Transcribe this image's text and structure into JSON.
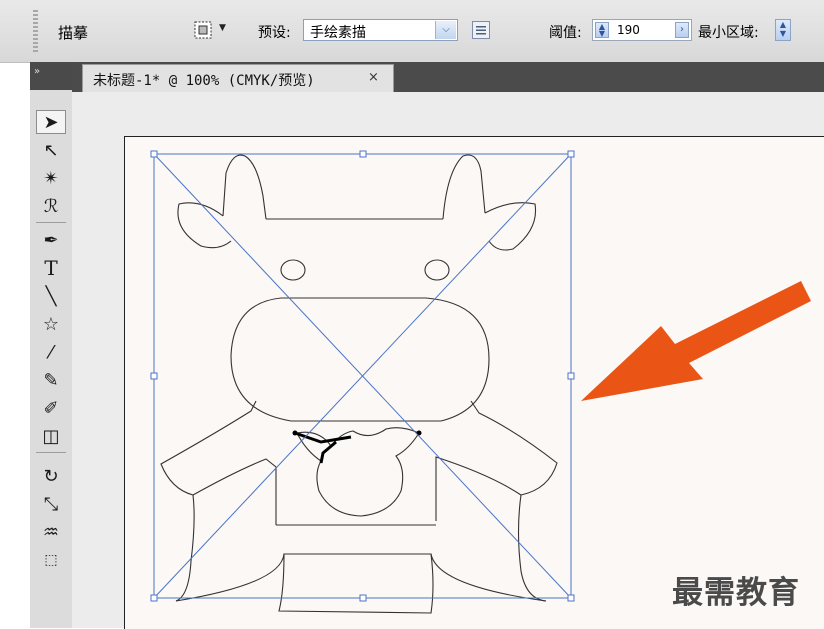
{
  "control_bar": {
    "tool_name": "描摹",
    "preset": {
      "label": "预设:",
      "value": "手绘素描",
      "icon": "trace-preset-icon",
      "dropdown_icon": "chevron-down-icon"
    },
    "options_icon": "tracing-options-icon",
    "threshold": {
      "label": "阈值:",
      "value": "190"
    },
    "min_area": {
      "label": "最小区域:"
    }
  },
  "document": {
    "tab_title": "未标题-1* @ 100% (CMYK/预览)",
    "close_symbol": "×"
  },
  "toolbox": {
    "collapse_symbol": "»",
    "tools": [
      "selection-tool-icon",
      "direct-selection-tool-icon",
      "magic-wand-icon",
      "lasso-icon",
      "pen-icon",
      "type-icon",
      "line-segment-icon",
      "star-icon",
      "paintbrush-icon",
      "pencil-icon",
      "blob-brush-icon",
      "eraser-icon",
      "rotate-icon",
      "scale-icon",
      "warp-icon",
      "free-transform-icon"
    ]
  },
  "canvas": {
    "arrow_color": "#ea5516",
    "bbox_color": "#4a74c8",
    "artboard_color": "#fbf8f6"
  },
  "watermark": "最需教育"
}
